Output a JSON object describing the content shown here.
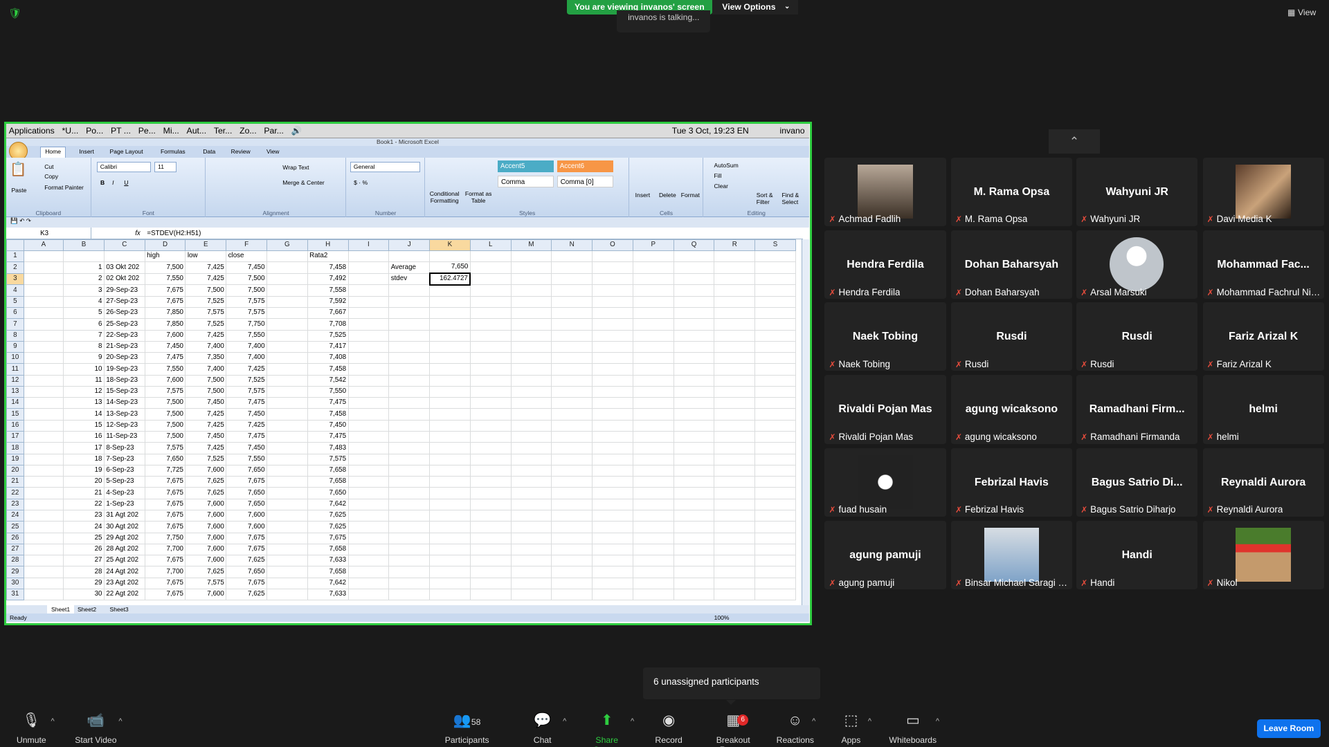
{
  "top": {
    "viewing_banner": "You are viewing invanos' screen",
    "view_options": "View Options",
    "talking": "invanos is talking...",
    "view_button": "View"
  },
  "taskbar": {
    "items": [
      "Applications",
      "*U...",
      "Po...",
      "PT ...",
      "Pe...",
      "Mi...",
      "Aut...",
      "Ter...",
      "Zo...",
      "Par..."
    ],
    "clock": "Tue  3 Oct, 19:23 EN",
    "user": "invano"
  },
  "excel": {
    "title": "Book1 - Microsoft Excel",
    "tabs": [
      "Home",
      "Insert",
      "Page Layout",
      "Formulas",
      "Data",
      "Review",
      "View"
    ],
    "ribbon": {
      "paste": "Paste",
      "cut": "Cut",
      "copy": "Copy",
      "format_painter": "Format Painter",
      "clipboard": "Clipboard",
      "font_name": "Calibri",
      "font_size": "11",
      "font": "Font",
      "wrap_text": "Wrap Text",
      "merge_center": "Merge & Center",
      "alignment": "Alignment",
      "number_format": "General",
      "number": "Number",
      "conditional": "Conditional Formatting",
      "format_table": "Format as Table",
      "accent5": "Accent5",
      "accent6": "Accent6",
      "comma": "Comma",
      "comma0": "Comma [0]",
      "styles": "Styles",
      "insert": "Insert",
      "delete": "Delete",
      "format": "Format",
      "cells": "Cells",
      "autosum": "AutoSum",
      "fill": "Fill",
      "clear": "Clear",
      "sort": "Sort & Filter",
      "find": "Find & Select",
      "editing": "Editing"
    },
    "name_box": "K3",
    "formula": "=STDEV(H2:H51)",
    "columns": [
      "A",
      "B",
      "C",
      "D",
      "E",
      "F",
      "G",
      "H",
      "I",
      "J",
      "K",
      "L",
      "M",
      "N",
      "O",
      "P",
      "Q",
      "R",
      "S"
    ],
    "header_row": {
      "D": "high",
      "E": "low",
      "F": "close",
      "H": "Rata2"
    },
    "rows": [
      [
        "1",
        "03 Okt 202",
        "7,500",
        "7,425",
        "7,450",
        "7,458"
      ],
      [
        "2",
        "02 Okt 202",
        "7,550",
        "7,425",
        "7,500",
        "7,492"
      ],
      [
        "3",
        "29-Sep-23",
        "7,675",
        "7,500",
        "7,500",
        "7,558"
      ],
      [
        "4",
        "27-Sep-23",
        "7,675",
        "7,525",
        "7,575",
        "7,592"
      ],
      [
        "5",
        "26-Sep-23",
        "7,850",
        "7,575",
        "7,575",
        "7,667"
      ],
      [
        "6",
        "25-Sep-23",
        "7,850",
        "7,525",
        "7,750",
        "7,708"
      ],
      [
        "7",
        "22-Sep-23",
        "7,600",
        "7,425",
        "7,550",
        "7,525"
      ],
      [
        "8",
        "21-Sep-23",
        "7,450",
        "7,400",
        "7,400",
        "7,417"
      ],
      [
        "9",
        "20-Sep-23",
        "7,475",
        "7,350",
        "7,400",
        "7,408"
      ],
      [
        "10",
        "19-Sep-23",
        "7,550",
        "7,400",
        "7,425",
        "7,458"
      ],
      [
        "11",
        "18-Sep-23",
        "7,600",
        "7,500",
        "7,525",
        "7,542"
      ],
      [
        "12",
        "15-Sep-23",
        "7,575",
        "7,500",
        "7,575",
        "7,550"
      ],
      [
        "13",
        "14-Sep-23",
        "7,500",
        "7,450",
        "7,475",
        "7,475"
      ],
      [
        "14",
        "13-Sep-23",
        "7,500",
        "7,425",
        "7,450",
        "7,458"
      ],
      [
        "15",
        "12-Sep-23",
        "7,500",
        "7,425",
        "7,425",
        "7,450"
      ],
      [
        "16",
        "11-Sep-23",
        "7,500",
        "7,450",
        "7,475",
        "7,475"
      ],
      [
        "17",
        "8-Sep-23",
        "7,575",
        "7,425",
        "7,450",
        "7,483"
      ],
      [
        "18",
        "7-Sep-23",
        "7,650",
        "7,525",
        "7,550",
        "7,575"
      ],
      [
        "19",
        "6-Sep-23",
        "7,725",
        "7,600",
        "7,650",
        "7,658"
      ],
      [
        "20",
        "5-Sep-23",
        "7,675",
        "7,625",
        "7,675",
        "7,658"
      ],
      [
        "21",
        "4-Sep-23",
        "7,675",
        "7,625",
        "7,650",
        "7,650"
      ],
      [
        "22",
        "1-Sep-23",
        "7,675",
        "7,600",
        "7,650",
        "7,642"
      ],
      [
        "23",
        "31 Agt 202",
        "7,675",
        "7,600",
        "7,600",
        "7,625"
      ],
      [
        "24",
        "30 Agt 202",
        "7,675",
        "7,600",
        "7,600",
        "7,625"
      ],
      [
        "25",
        "29 Agt 202",
        "7,750",
        "7,600",
        "7,675",
        "7,675"
      ],
      [
        "26",
        "28 Agt 202",
        "7,700",
        "7,600",
        "7,675",
        "7,658"
      ],
      [
        "27",
        "25 Agt 202",
        "7,675",
        "7,600",
        "7,625",
        "7,633"
      ],
      [
        "28",
        "24 Agt 202",
        "7,700",
        "7,625",
        "7,650",
        "7,658"
      ],
      [
        "29",
        "23 Agt 202",
        "7,675",
        "7,575",
        "7,675",
        "7,642"
      ],
      [
        "30",
        "22 Agt 202",
        "7,675",
        "7,600",
        "7,625",
        "7,633"
      ]
    ],
    "stats": {
      "average_label": "Average",
      "average_value": "7,650",
      "stdev_label": "stdev",
      "stdev_value": "162.4727"
    },
    "sheets": [
      "Sheet1",
      "Sheet2",
      "Sheet3"
    ],
    "status": "Ready",
    "zoom": "100%"
  },
  "participants": [
    {
      "name": "Achmad Fadlih",
      "display": "",
      "photo": "p0"
    },
    {
      "name": "M. Rama Opsa",
      "display": "M. Rama Opsa",
      "photo": ""
    },
    {
      "name": "Wahyuni JR",
      "display": "Wahyuni JR",
      "photo": ""
    },
    {
      "name": "Davi Media K",
      "display": "",
      "photo": "p2"
    },
    {
      "name": "Hendra Ferdila",
      "display": "Hendra Ferdila",
      "photo": ""
    },
    {
      "name": "Dohan Baharsyah",
      "display": "Dohan Baharsyah",
      "photo": ""
    },
    {
      "name": "Arsal Marsuki",
      "display": "",
      "photo": "p1"
    },
    {
      "name": "Mohammad Fachrul Nizar",
      "display": "Mohammad Fac...",
      "photo": ""
    },
    {
      "name": "Naek Tobing",
      "display": "Naek Tobing",
      "photo": ""
    },
    {
      "name": "Rusdi",
      "display": "Rusdi",
      "photo": ""
    },
    {
      "name": "Rusdi",
      "display": "Rusdi",
      "photo": ""
    },
    {
      "name": "Fariz Arizal K",
      "display": "Fariz Arizal K",
      "photo": ""
    },
    {
      "name": "Rivaldi Pojan Mas",
      "display": "Rivaldi Pojan Mas",
      "photo": ""
    },
    {
      "name": "agung wicaksono",
      "display": "agung wicaksono",
      "photo": ""
    },
    {
      "name": "Ramadhani Firmanda",
      "display": "Ramadhani Firm...",
      "photo": ""
    },
    {
      "name": "helmi",
      "display": "helmi",
      "photo": ""
    },
    {
      "name": "fuad husain",
      "display": "",
      "photo": "p3"
    },
    {
      "name": "Febrizal Havis",
      "display": "Febrizal Havis",
      "photo": ""
    },
    {
      "name": "Bagus Satrio Diharjo",
      "display": "Bagus Satrio Di...",
      "photo": ""
    },
    {
      "name": "Reynaldi Aurora",
      "display": "Reynaldi Aurora",
      "photo": ""
    },
    {
      "name": "agung pamuji",
      "display": "agung pamuji",
      "photo": ""
    },
    {
      "name": "Binsar Michael Saragi _1...",
      "display": "",
      "photo": "p4"
    },
    {
      "name": "Handi",
      "display": "Handi",
      "photo": ""
    },
    {
      "name": "Nikol",
      "display": "",
      "photo": "p5"
    }
  ],
  "unassigned": "6 unassigned participants",
  "toolbar": {
    "unmute": "Unmute",
    "start_video": "Start Video",
    "participants_count": "58",
    "participants": "Participants",
    "chat": "Chat",
    "share_screen": "Share Screen",
    "record": "Record",
    "breakout_badge": "6",
    "breakout": "Breakout Rooms",
    "reactions": "Reactions",
    "apps": "Apps",
    "whiteboards": "Whiteboards",
    "leave": "Leave Room"
  },
  "colors": {
    "share_border": "#2ecc40",
    "banner_green": "#23a043",
    "leave_blue": "#0e72ed",
    "mute_red": "#e74c3c"
  }
}
